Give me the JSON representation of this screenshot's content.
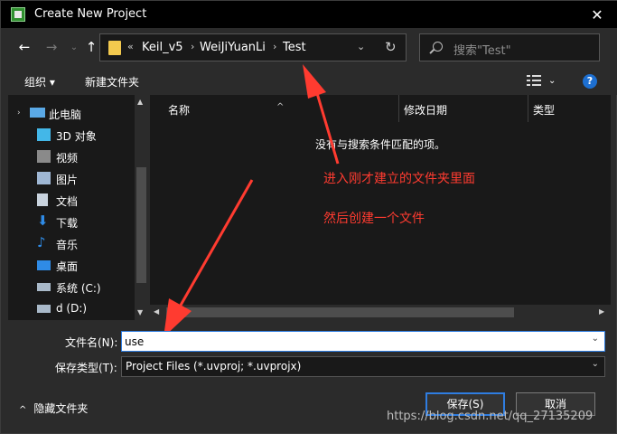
{
  "window": {
    "title": "Create New Project",
    "close_glyph": "✕"
  },
  "nav": {
    "back_glyph": "←",
    "forward_glyph": "→",
    "up_glyph": "↑",
    "dropdown_glyph": "⌄",
    "breadcrumb_prefix": "«",
    "breadcrumb": [
      "Keil_v5",
      "WeiJiYuanLi",
      "Test"
    ],
    "separator_glyph": "›",
    "refresh_glyph": "↻",
    "search_placeholder": "搜索\"Test\""
  },
  "toolbar": {
    "organize": "组织 ▾",
    "new_folder": "新建文件夹",
    "help": "?"
  },
  "sidebar": {
    "items": [
      {
        "label": "此电脑",
        "icon": "computer-icon",
        "color": "#5aa9e6"
      },
      {
        "label": "3D 对象",
        "icon": "cube-icon",
        "color": "#43b7e8"
      },
      {
        "label": "视频",
        "icon": "video-icon",
        "color": "#8a8a8a"
      },
      {
        "label": "图片",
        "icon": "picture-icon",
        "color": "#9fb7d4"
      },
      {
        "label": "文档",
        "icon": "document-icon",
        "color": "#c9d3de"
      },
      {
        "label": "下载",
        "icon": "download-icon",
        "color": "#2f8be6"
      },
      {
        "label": "音乐",
        "icon": "music-icon",
        "color": "#2f8be6"
      },
      {
        "label": "桌面",
        "icon": "desktop-icon",
        "color": "#2f8be6"
      },
      {
        "label": "系统 (C:)",
        "icon": "drive-icon",
        "color": "#a9b9c9"
      },
      {
        "label": "d (D:)",
        "icon": "drive-icon",
        "color": "#a9b9c9"
      }
    ],
    "expand_glyph": "›"
  },
  "filelist": {
    "columns": [
      "名称",
      "修改日期",
      "类型"
    ],
    "sort_glyph": "^",
    "empty_message": "没有与搜索条件匹配的项。"
  },
  "annotations": {
    "line1": "进入刚才建立的文件夹里面",
    "line2": "然后创建一个文件",
    "color": "#ff3b30"
  },
  "form": {
    "filename_label": "文件名(N):",
    "filename_value": "use",
    "filetype_label": "保存类型(T):",
    "filetype_value": "Project Files (*.uvproj; *.uvprojx)",
    "dropdown_glyph": "⌄"
  },
  "footer": {
    "hide_folders": "隐藏文件夹",
    "hide_folders_caret": "^",
    "save": "保存(S)",
    "cancel": "取消",
    "watermark": "https://blog.csdn.net/qq_27135209"
  }
}
